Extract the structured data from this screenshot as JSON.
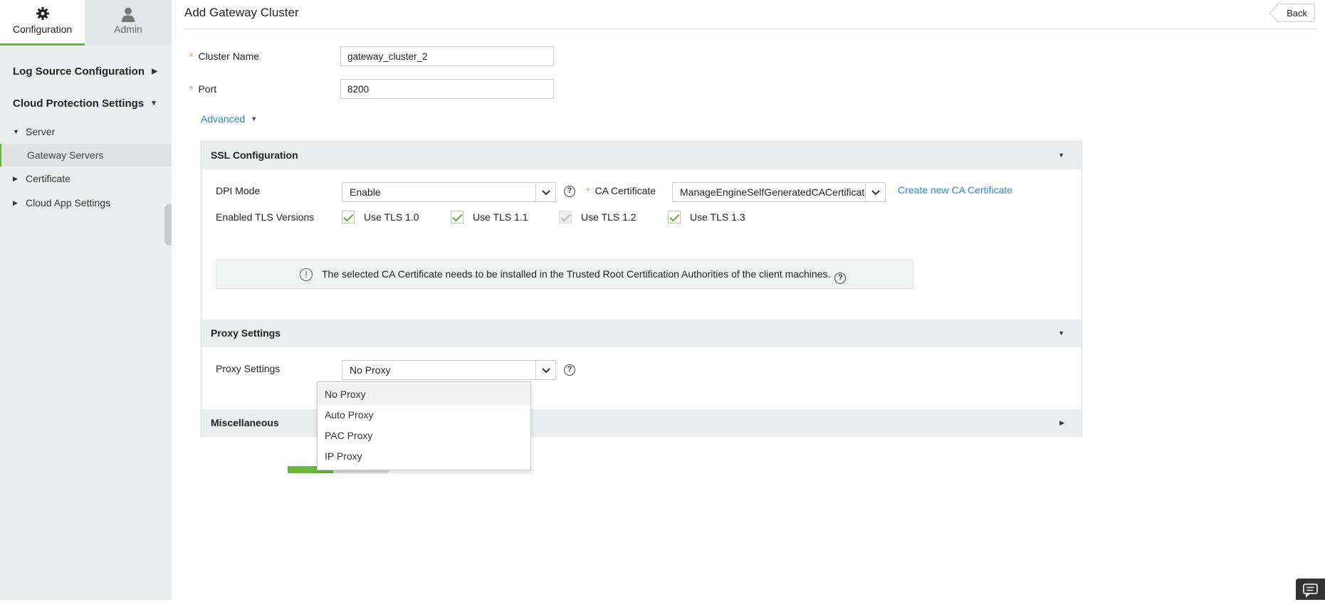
{
  "sidebar": {
    "tabs": [
      {
        "label": "Configuration",
        "icon": "gear-icon"
      },
      {
        "label": "Admin",
        "icon": "user-icon"
      }
    ],
    "sections": [
      {
        "label": "Log Source Configuration"
      },
      {
        "label": "Cloud Protection Settings"
      }
    ],
    "items": {
      "server": "Server",
      "gateway_servers": "Gateway Servers",
      "certificate": "Certificate",
      "cloud_app_settings": "Cloud App Settings"
    }
  },
  "header": {
    "title": "Add Gateway Cluster",
    "back_label": "Back"
  },
  "form": {
    "cluster_name_label": "Cluster Name",
    "cluster_name_value": "gateway_cluster_2",
    "port_label": "Port",
    "port_value": "8200",
    "required_mark": "*",
    "advanced_label": "Advanced"
  },
  "ssl": {
    "title": "SSL Configuration",
    "dpi_label": "DPI Mode",
    "dpi_value": "Enable",
    "ca_label": "CA Certificate",
    "ca_value": "ManageEngineSelfGeneratedCACertificate",
    "create_ca_link": "Create new CA Certificate",
    "tls_label": "Enabled TLS Versions",
    "tls_options": [
      {
        "label": "Use TLS 1.0",
        "checked": true,
        "disabled": false
      },
      {
        "label": "Use TLS 1.1",
        "checked": true,
        "disabled": false
      },
      {
        "label": "Use TLS 1.2",
        "checked": true,
        "disabled": true
      },
      {
        "label": "Use TLS 1.3",
        "checked": true,
        "disabled": false
      }
    ],
    "info_text": "The selected CA Certificate needs to be installed in the Trusted Root Certification Authorities of the client machines."
  },
  "proxy": {
    "title": "Proxy Settings",
    "label": "Proxy Settings",
    "value": "No Proxy",
    "options": [
      "No Proxy",
      "Auto Proxy",
      "PAC Proxy",
      "IP Proxy"
    ]
  },
  "misc": {
    "title": "Miscellaneous"
  },
  "colors": {
    "accent": "#6cb33f",
    "link": "#2a87c8",
    "required": "#e8a33c",
    "sidebar_bg": "#ebeeee"
  }
}
